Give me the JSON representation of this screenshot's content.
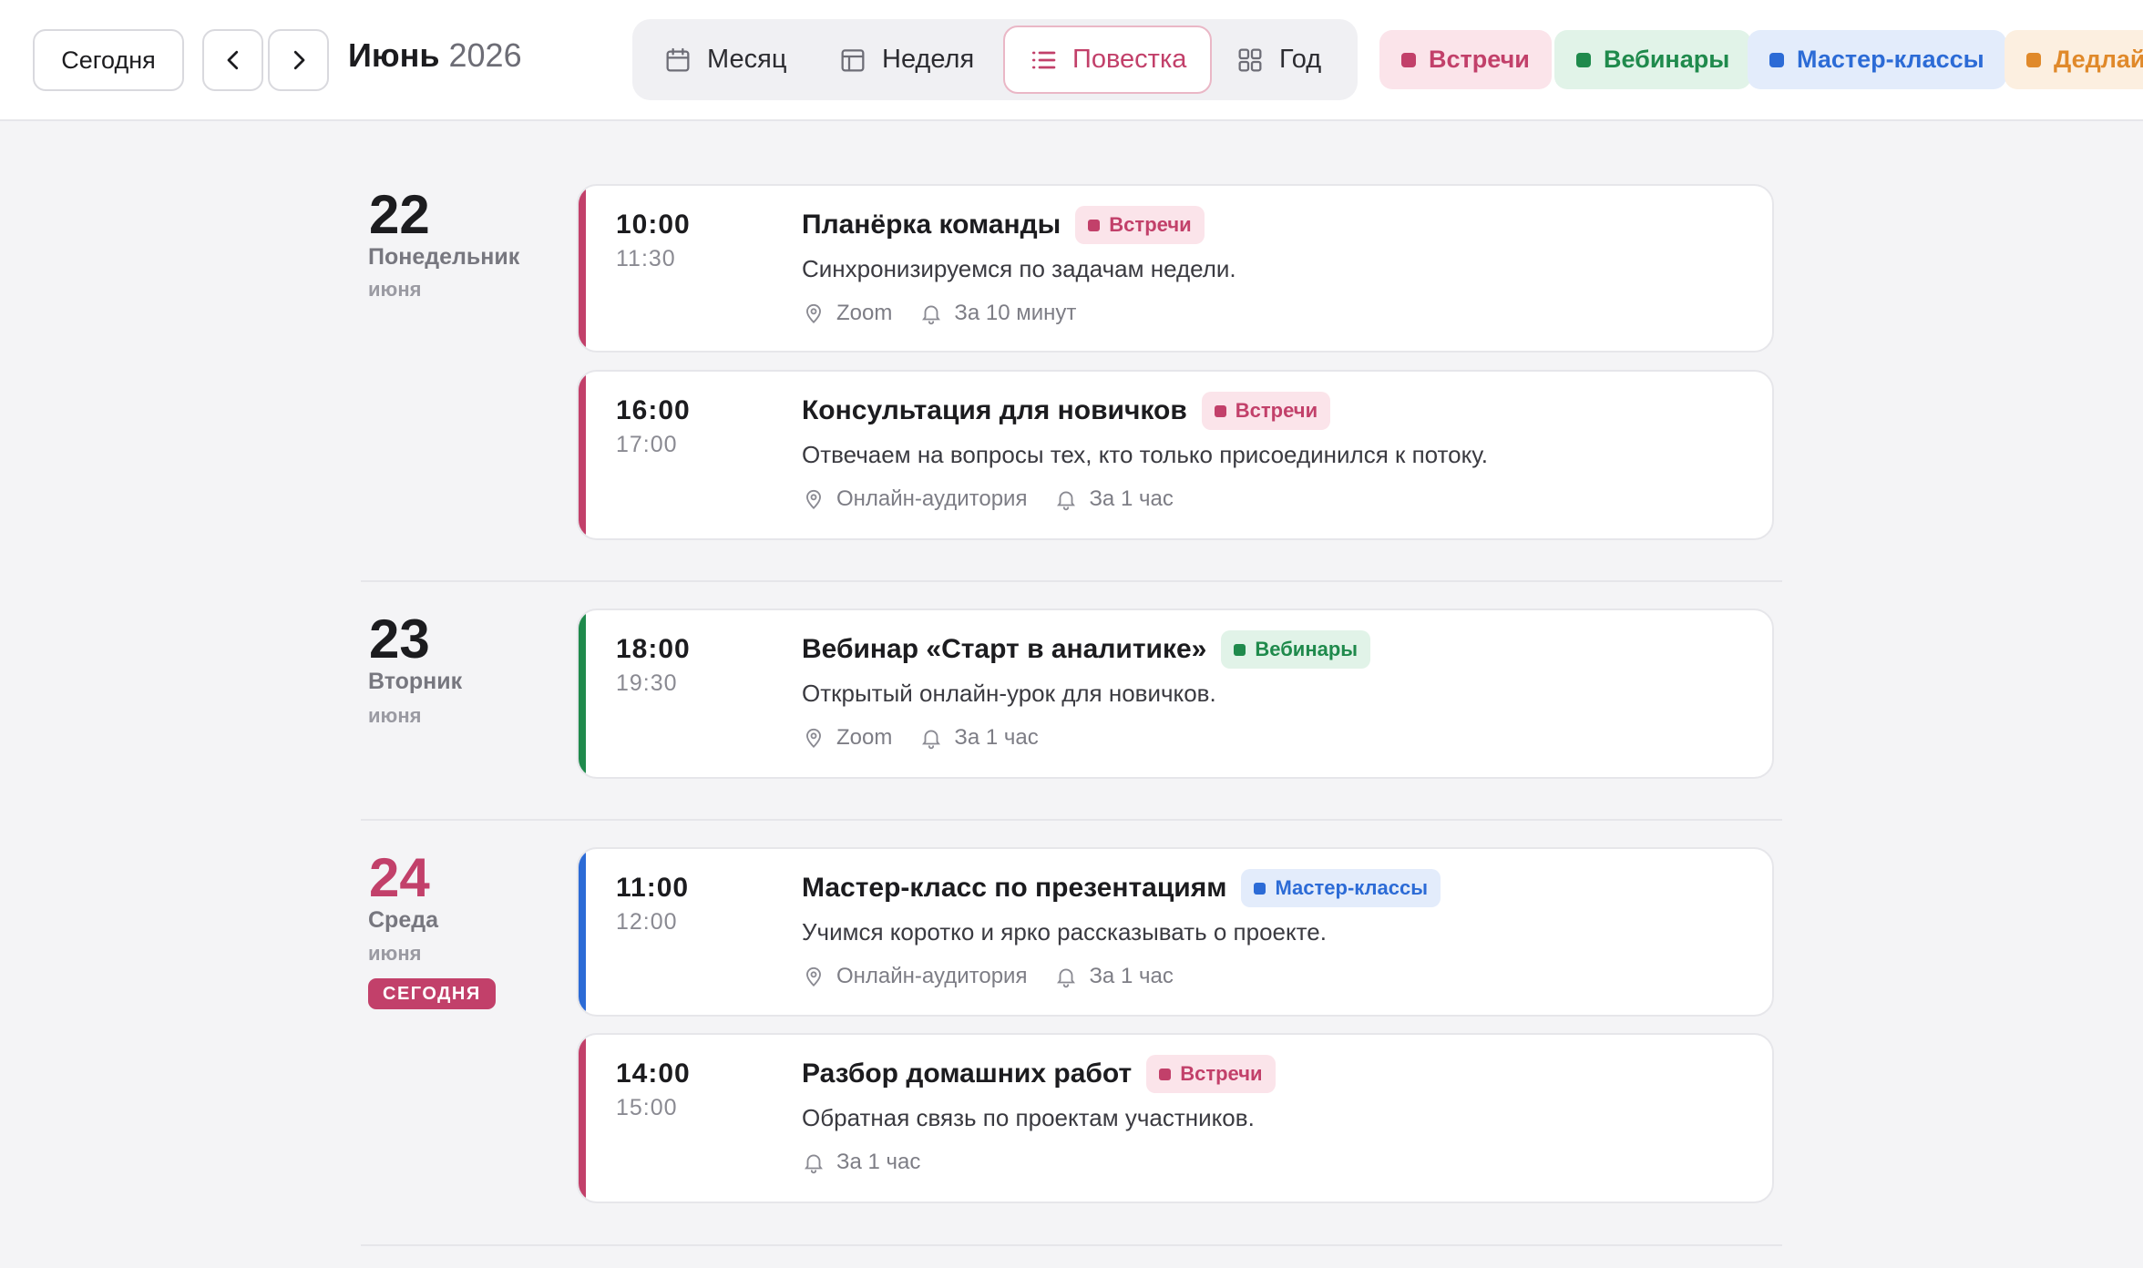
{
  "header": {
    "today_label": "Сегодня",
    "month": "Июнь",
    "year": "2026",
    "views": [
      {
        "label": "Месяц",
        "icon": "calendar-icon",
        "active": false
      },
      {
        "label": "Неделя",
        "icon": "week-icon",
        "active": false
      },
      {
        "label": "Повестка",
        "icon": "list-icon",
        "active": true
      },
      {
        "label": "Год",
        "icon": "grid-icon",
        "active": false
      }
    ],
    "categories": [
      {
        "label": "Встречи",
        "color": "#c2406a",
        "bg": "#fbe4ea"
      },
      {
        "label": "Вебинары",
        "color": "#1f8a4c",
        "bg": "#e1f3e8"
      },
      {
        "label": "Мастер-классы",
        "color": "#2c6bd6",
        "bg": "#e3ecfb"
      },
      {
        "label": "Дедлайны",
        "color": "#e0892a",
        "bg": "#fcefe0"
      }
    ]
  },
  "days": [
    {
      "num": "22",
      "weekday": "Понедельник",
      "month": "июня",
      "events": [
        {
          "start": "10:00",
          "end": "11:30",
          "title": "Планёрка команды",
          "tag": "Встречи",
          "desc": "Синхронизируемся по задачам недели.",
          "location": "Zoom",
          "reminder": "За 10 минут"
        },
        {
          "start": "16:00",
          "end": "17:00",
          "title": "Консультация для новичков",
          "tag": "Встречи",
          "desc": "Отвечаем на вопросы тех, кто только присоединился к потоку.",
          "location": "Онлайн-аудитория",
          "reminder": "За 1 час"
        }
      ]
    },
    {
      "num": "23",
      "weekday": "Вторник",
      "month": "июня",
      "events": [
        {
          "start": "18:00",
          "end": "19:30",
          "title": "Вебинар «Старт в аналитике»",
          "tag": "Вебинары",
          "desc": "Открытый онлайн-урок для новичков.",
          "location": "Zoom",
          "reminder": "За 1 час"
        }
      ]
    },
    {
      "num": "24",
      "weekday": "Среда",
      "month": "июня",
      "today_badge": "СЕГОДНЯ",
      "events": [
        {
          "start": "11:00",
          "end": "12:00",
          "title": "Мастер-класс по презентациям",
          "tag": "Мастер-классы",
          "desc": "Учимся коротко и ярко рассказывать о проекте.",
          "location": "Онлайн-аудитория",
          "reminder": "За 1 час"
        },
        {
          "start": "14:00",
          "end": "15:00",
          "title": "Разбор домашних работ",
          "tag": "Встречи",
          "desc": "Обратная связь по проектам участников.",
          "reminder": "За 1 час"
        }
      ]
    }
  ]
}
